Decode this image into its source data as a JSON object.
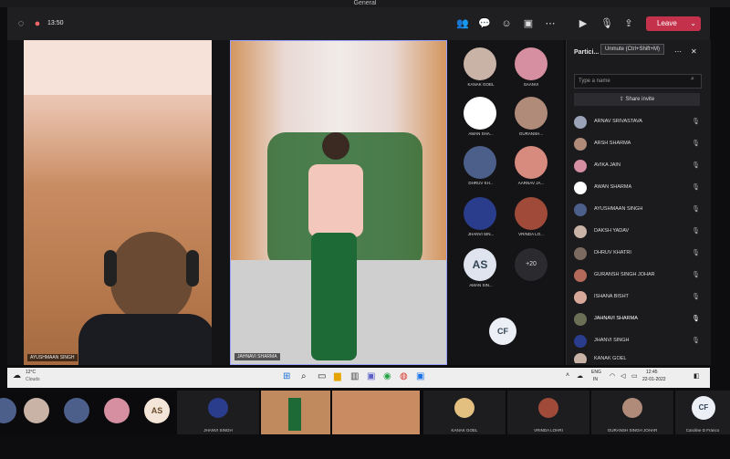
{
  "window": {
    "title": "General"
  },
  "toolbar": {
    "time": "13:50",
    "leave_label": "Leave",
    "tooltip": "Unmute (Ctrl+Shift+M)"
  },
  "stage": {
    "left_tile_name": "AYUSHMAAN SINGH",
    "center_tile_name": "JAHNAVI SHARMA",
    "grid": [
      {
        "name": "KANAK GOEL"
      },
      {
        "name": "SAANVI"
      },
      {
        "name": "AMAN SHA..."
      },
      {
        "name": "GURANSH..."
      },
      {
        "name": "DHRUV KH..."
      },
      {
        "name": "AARNAV JA..."
      },
      {
        "name": "JHANVI SIN..."
      },
      {
        "name": "VRINDA LO..."
      },
      {
        "name": "AMAN SIN...",
        "initials": "AS"
      },
      {
        "initials": "+20"
      }
    ],
    "cf_initials": "CF"
  },
  "panel": {
    "title": "Partici...",
    "search_placeholder": "Type a name",
    "share_label": "Share invite",
    "participants": [
      {
        "name": "ARNAV SRIVASTAVA"
      },
      {
        "name": "ARSH SHARMA"
      },
      {
        "name": "AVIKA JAIN"
      },
      {
        "name": "AWAN SHARMA"
      },
      {
        "name": "AYUSHMAAN SINGH"
      },
      {
        "name": "DAKSH YADAV"
      },
      {
        "name": "DHRUV KHATRI"
      },
      {
        "name": "GURANSH SINGH JOHAR"
      },
      {
        "name": "ISHANA BISHT"
      },
      {
        "name": "JAHNAVI SHARMA"
      },
      {
        "name": "JHANVI SINGH"
      },
      {
        "name": "KANAK GOEL"
      }
    ]
  },
  "taskbar": {
    "weather_temp": "12°C",
    "weather_desc": "Clouds",
    "lang": "ENG",
    "lang2": "IN",
    "clock_time": "12:45",
    "clock_date": "22-01-2022"
  },
  "strip": {
    "initials_as": "AS",
    "initials_cf": "CF",
    "names": [
      "JHANVI SINGH",
      "KANAK GOEL",
      "VRINDA LOHRI",
      "GURANSH SINGH JOHAR",
      "Caroline D Franco"
    ]
  }
}
